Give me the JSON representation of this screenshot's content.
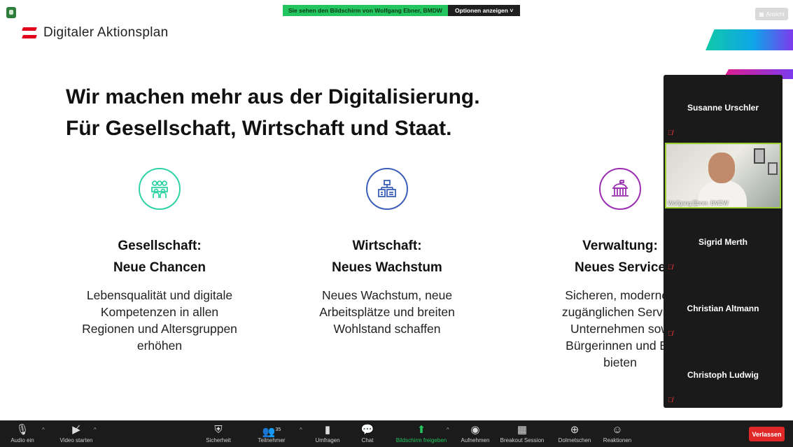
{
  "share_banner": {
    "viewing_text": "Sie sehen den Bildschirm von Wolfgang Ebner, BMDW",
    "options_label": "Optionen anzeigen ˅"
  },
  "view_button": "Ansicht",
  "slide": {
    "logo_text": "Digitaler Aktionsplan",
    "headline_line1": "Wir machen mehr aus der Digitalisierung.",
    "headline_line2": "Für Gesellschaft, Wirtschaft und Staat.",
    "colors": {
      "gesellschaft": "#2fd3a5",
      "wirtschaft": "#3b5fb8",
      "verwaltung": "#9a2fb1",
      "brand_red": "#e3001b"
    },
    "columns": [
      {
        "icon": "people-group-icon",
        "head1": "Gesellschaft:",
        "head2": "Neue Chancen",
        "body": [
          "Lebensqualität und digitale",
          "Kompetenzen in allen",
          "Regionen und Altersgruppen",
          "erhöhen"
        ]
      },
      {
        "icon": "business-org-icon",
        "head1": "Wirtschaft:",
        "head2": "Neues Wachstum",
        "body": [
          "Neues Wachstum, neue",
          "Arbeitsplätze und breiten",
          "Wohlstand schaffen"
        ]
      },
      {
        "icon": "government-building-icon",
        "head1": "Verwaltung:",
        "head2": "Neues Service",
        "body": [
          "Sicheren, modernen",
          "zugänglichen Service",
          "Unternehmen sow",
          "Bürgerinnen und Bü",
          "bieten"
        ]
      }
    ]
  },
  "participants": [
    {
      "name": "Susanne Urschler",
      "muted": true
    },
    {
      "name": "Wolfgang Ebner, BMDW",
      "video": true
    },
    {
      "name": "Sigrid Merth",
      "muted": true
    },
    {
      "name": "Christian Altmann",
      "muted": true
    },
    {
      "name": "Christoph Ludwig",
      "muted": true
    }
  ],
  "toolbar": {
    "audio": "Audio ein",
    "video": "Video starten",
    "security": "Sicherheit",
    "participants": "Teilnehmer",
    "participants_count": "35",
    "polls": "Umfragen",
    "chat": "Chat",
    "share": "Bildschirm freigeben",
    "record": "Aufnehmen",
    "breakout": "Breakout Session",
    "interpret": "Dolmetschen",
    "reactions": "Reaktionen",
    "leave": "Verlassen"
  }
}
